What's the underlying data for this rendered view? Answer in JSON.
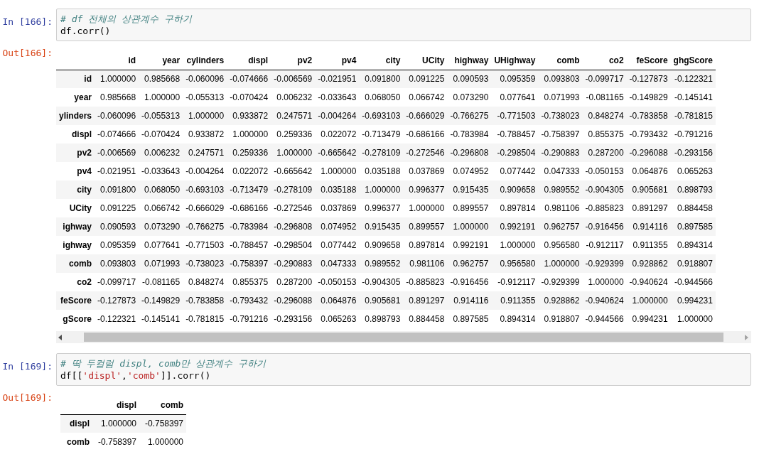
{
  "cells": [
    {
      "in_prompt": "In [166]:",
      "code_lines": [
        [
          {
            "kind": "comment",
            "text": "# df 전체의 상관계수 구하기"
          }
        ],
        [
          {
            "kind": "plain",
            "text": "df.corr()"
          }
        ]
      ],
      "out_prompt": "Out[166]:",
      "table": {
        "columns": [
          "id",
          "year",
          "cylinders",
          "displ",
          "pv2",
          "pv4",
          "city",
          "UCity",
          "highway",
          "UHighway",
          "comb",
          "co2",
          "feScore",
          "ghgScore"
        ],
        "rows": [
          {
            "label": "id",
            "values": [
              "1.000000",
              "0.985668",
              "-0.060096",
              "-0.074666",
              "-0.006569",
              "-0.021951",
              "0.091800",
              "0.091225",
              "0.090593",
              "0.095359",
              "0.093803",
              "-0.099717",
              "-0.127873",
              "-0.122321"
            ]
          },
          {
            "label": "year",
            "values": [
              "0.985668",
              "1.000000",
              "-0.055313",
              "-0.070424",
              "0.006232",
              "-0.033643",
              "0.068050",
              "0.066742",
              "0.073290",
              "0.077641",
              "0.071993",
              "-0.081165",
              "-0.149829",
              "-0.145141"
            ]
          },
          {
            "label": "ylinders",
            "values": [
              "-0.060096",
              "-0.055313",
              "1.000000",
              "0.933872",
              "0.247571",
              "-0.004264",
              "-0.693103",
              "-0.666029",
              "-0.766275",
              "-0.771503",
              "-0.738023",
              "0.848274",
              "-0.783858",
              "-0.781815"
            ]
          },
          {
            "label": "displ",
            "values": [
              "-0.074666",
              "-0.070424",
              "0.933872",
              "1.000000",
              "0.259336",
              "0.022072",
              "-0.713479",
              "-0.686166",
              "-0.783984",
              "-0.788457",
              "-0.758397",
              "0.855375",
              "-0.793432",
              "-0.791216"
            ]
          },
          {
            "label": "pv2",
            "values": [
              "-0.006569",
              "0.006232",
              "0.247571",
              "0.259336",
              "1.000000",
              "-0.665642",
              "-0.278109",
              "-0.272546",
              "-0.296808",
              "-0.298504",
              "-0.290883",
              "0.287200",
              "-0.296088",
              "-0.293156"
            ]
          },
          {
            "label": "pv4",
            "values": [
              "-0.021951",
              "-0.033643",
              "-0.004264",
              "0.022072",
              "-0.665642",
              "1.000000",
              "0.035188",
              "0.037869",
              "0.074952",
              "0.077442",
              "0.047333",
              "-0.050153",
              "0.064876",
              "0.065263"
            ]
          },
          {
            "label": "city",
            "values": [
              "0.091800",
              "0.068050",
              "-0.693103",
              "-0.713479",
              "-0.278109",
              "0.035188",
              "1.000000",
              "0.996377",
              "0.915435",
              "0.909658",
              "0.989552",
              "-0.904305",
              "0.905681",
              "0.898793"
            ]
          },
          {
            "label": "UCity",
            "values": [
              "0.091225",
              "0.066742",
              "-0.666029",
              "-0.686166",
              "-0.272546",
              "0.037869",
              "0.996377",
              "1.000000",
              "0.899557",
              "0.897814",
              "0.981106",
              "-0.885823",
              "0.891297",
              "0.884458"
            ]
          },
          {
            "label": "ighway",
            "values": [
              "0.090593",
              "0.073290",
              "-0.766275",
              "-0.783984",
              "-0.296808",
              "0.074952",
              "0.915435",
              "0.899557",
              "1.000000",
              "0.992191",
              "0.962757",
              "-0.916456",
              "0.914116",
              "0.897585"
            ]
          },
          {
            "label": "ighway",
            "values": [
              "0.095359",
              "0.077641",
              "-0.771503",
              "-0.788457",
              "-0.298504",
              "0.077442",
              "0.909658",
              "0.897814",
              "0.992191",
              "1.000000",
              "0.956580",
              "-0.912117",
              "0.911355",
              "0.894314"
            ]
          },
          {
            "label": "comb",
            "values": [
              "0.093803",
              "0.071993",
              "-0.738023",
              "-0.758397",
              "-0.290883",
              "0.047333",
              "0.989552",
              "0.981106",
              "0.962757",
              "0.956580",
              "1.000000",
              "-0.929399",
              "0.928862",
              "0.918807"
            ]
          },
          {
            "label": "co2",
            "values": [
              "-0.099717",
              "-0.081165",
              "0.848274",
              "0.855375",
              "0.287200",
              "-0.050153",
              "-0.904305",
              "-0.885823",
              "-0.916456",
              "-0.912117",
              "-0.929399",
              "1.000000",
              "-0.940624",
              "-0.944566"
            ]
          },
          {
            "label": "feScore",
            "values": [
              "-0.127873",
              "-0.149829",
              "-0.783858",
              "-0.793432",
              "-0.296088",
              "0.064876",
              "0.905681",
              "0.891297",
              "0.914116",
              "0.911355",
              "0.928862",
              "-0.940624",
              "1.000000",
              "0.994231"
            ]
          },
          {
            "label": "gScore",
            "values": [
              "-0.122321",
              "-0.145141",
              "-0.781815",
              "-0.791216",
              "-0.293156",
              "0.065263",
              "0.898793",
              "0.884458",
              "0.897585",
              "0.894314",
              "0.918807",
              "-0.944566",
              "0.994231",
              "1.000000"
            ]
          }
        ],
        "scrolled": true
      }
    },
    {
      "in_prompt": "In [169]:",
      "code_lines": [
        [
          {
            "kind": "comment",
            "text": "# 딱 두컬럼 displ, comb만 상관계수 구하기"
          }
        ],
        [
          {
            "kind": "plain",
            "text": "df[["
          },
          {
            "kind": "string",
            "text": "'displ'"
          },
          {
            "kind": "plain",
            "text": ","
          },
          {
            "kind": "string",
            "text": "'comb'"
          },
          {
            "kind": "plain",
            "text": "]].corr()"
          }
        ]
      ],
      "out_prompt": "Out[169]:",
      "table": {
        "columns": [
          "displ",
          "comb"
        ],
        "rows": [
          {
            "label": "displ",
            "values": [
              "1.000000",
              "-0.758397"
            ]
          },
          {
            "label": "comb",
            "values": [
              "-0.758397",
              "1.000000"
            ]
          }
        ],
        "scrolled": false
      }
    }
  ]
}
